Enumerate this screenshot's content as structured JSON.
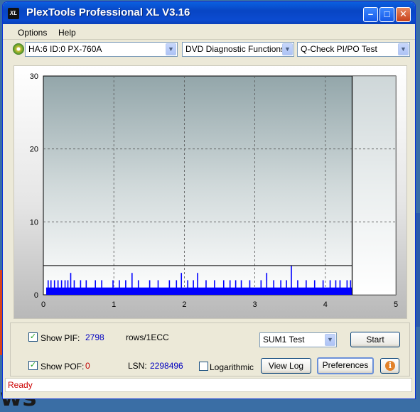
{
  "window": {
    "title": "PlexTools Professional XL V3.16",
    "app_icon_text": "XL"
  },
  "menu": [
    {
      "label": "Options"
    },
    {
      "label": "Help"
    }
  ],
  "toolbar": {
    "drive": "HA:6 ID:0  PX-760A",
    "function": "DVD Diagnostic Functions",
    "test": "Q-Check PI/PO Test"
  },
  "chart_data": {
    "type": "bar",
    "x_ticks": [
      "0",
      "1",
      "2",
      "3",
      "4",
      "5"
    ],
    "y_ticks": [
      "0",
      "10",
      "20",
      "30"
    ],
    "xlim": [
      0,
      5
    ],
    "ylim": [
      0,
      30
    ],
    "grid": true,
    "threshold_line": 4,
    "test_end_x": 4.38,
    "series": [
      {
        "color": "#0000ff",
        "baseline": 1,
        "values": [
          [
            0.06,
            2
          ],
          [
            0.1,
            2
          ],
          [
            0.15,
            2
          ],
          [
            0.2,
            2
          ],
          [
            0.25,
            2
          ],
          [
            0.3,
            2
          ],
          [
            0.34,
            2
          ],
          [
            0.38,
            3
          ],
          [
            0.43,
            2
          ],
          [
            0.52,
            2
          ],
          [
            0.6,
            2
          ],
          [
            0.73,
            2
          ],
          [
            0.82,
            2
          ],
          [
            0.98,
            2
          ],
          [
            1.07,
            2
          ],
          [
            1.16,
            2
          ],
          [
            1.25,
            3
          ],
          [
            1.34,
            2
          ],
          [
            1.5,
            2
          ],
          [
            1.62,
            2
          ],
          [
            1.78,
            2
          ],
          [
            1.88,
            2
          ],
          [
            1.95,
            3
          ],
          [
            2.04,
            2
          ],
          [
            2.12,
            2
          ],
          [
            2.18,
            3
          ],
          [
            2.3,
            2
          ],
          [
            2.42,
            2
          ],
          [
            2.55,
            2
          ],
          [
            2.64,
            2
          ],
          [
            2.72,
            2
          ],
          [
            2.8,
            2
          ],
          [
            2.92,
            2
          ],
          [
            3.08,
            2
          ],
          [
            3.16,
            3
          ],
          [
            3.26,
            2
          ],
          [
            3.36,
            2
          ],
          [
            3.44,
            2
          ],
          [
            3.51,
            4
          ],
          [
            3.6,
            2
          ],
          [
            3.72,
            2
          ],
          [
            3.84,
            2
          ],
          [
            3.96,
            2
          ],
          [
            4.06,
            2
          ],
          [
            4.14,
            2
          ],
          [
            4.2,
            2
          ],
          [
            4.3,
            2
          ],
          [
            4.35,
            2
          ]
        ]
      }
    ]
  },
  "controls": {
    "show_pif_label": "Show PIF:",
    "pif_value": "2798",
    "rows_label": "rows/1ECC",
    "show_pof_label": "Show POF:",
    "pof_value": "0",
    "lsn_label": "LSN:",
    "lsn_value": "2298496",
    "logarithmic_label": "Logarithmic",
    "test_select": "SUM1 Test",
    "start_button": "Start",
    "view_log_button": "View Log",
    "preferences_button": "Preferences",
    "info_icon": "i"
  },
  "status": {
    "text": "Ready"
  }
}
